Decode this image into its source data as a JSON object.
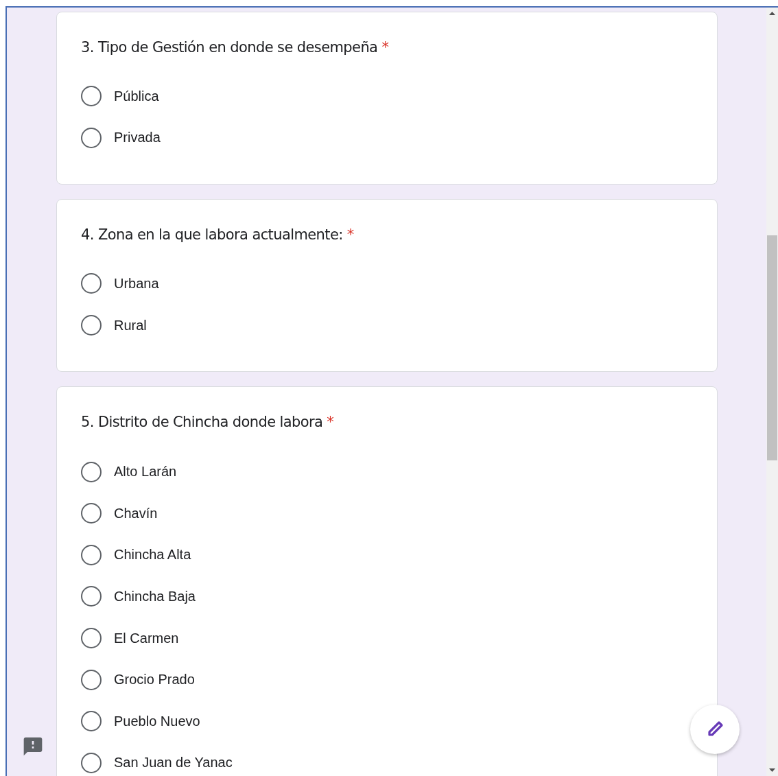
{
  "questions": [
    {
      "title": "3. Tipo de Gestión en donde se desempeña",
      "required_mark": "*",
      "options": [
        {
          "label": "Pública",
          "selected": false
        },
        {
          "label": "Privada",
          "selected": false
        }
      ]
    },
    {
      "title": "4. Zona en la que labora actualmente:",
      "required_mark": "*",
      "options": [
        {
          "label": "Urbana",
          "selected": false
        },
        {
          "label": "Rural",
          "selected": false
        }
      ]
    },
    {
      "title": "5. Distrito de Chincha donde labora",
      "required_mark": "*",
      "options": [
        {
          "label": "Alto Larán",
          "selected": false
        },
        {
          "label": "Chavín",
          "selected": false
        },
        {
          "label": "Chincha Alta",
          "selected": false
        },
        {
          "label": "Chincha Baja",
          "selected": false
        },
        {
          "label": "El Carmen",
          "selected": false
        },
        {
          "label": "Grocio Prado",
          "selected": false
        },
        {
          "label": "Pueblo Nuevo",
          "selected": false
        },
        {
          "label": "San Juan de Yanac",
          "selected": false
        }
      ]
    }
  ]
}
